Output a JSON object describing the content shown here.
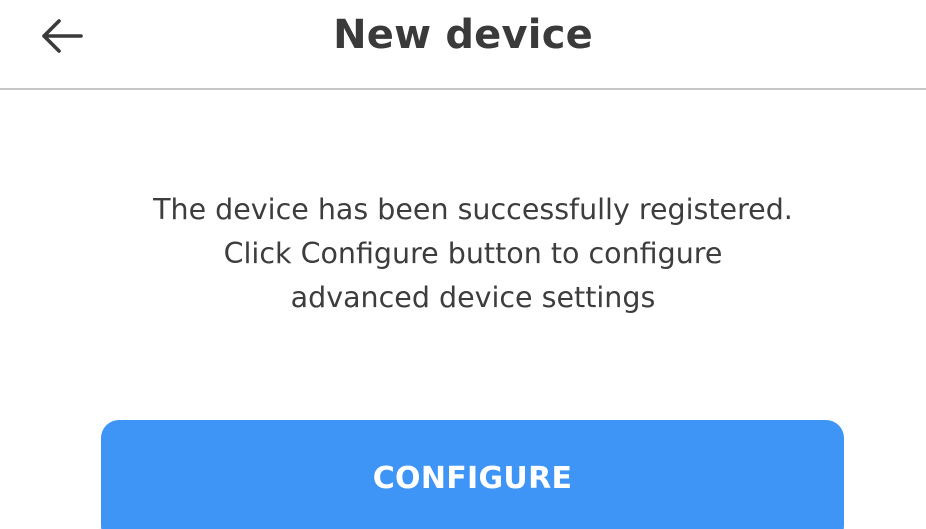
{
  "header": {
    "title": "New device",
    "back_icon": "arrow-left-icon"
  },
  "message": {
    "lines": [
      "The device has been successfully registered.",
      "Click Configure button to configure",
      "advanced device settings"
    ]
  },
  "actions": {
    "configure_label": "CONFIGURE"
  },
  "colors": {
    "primary_button": "#3f95f6",
    "divider": "#c6c6c6",
    "text": "#3d3d3d"
  }
}
